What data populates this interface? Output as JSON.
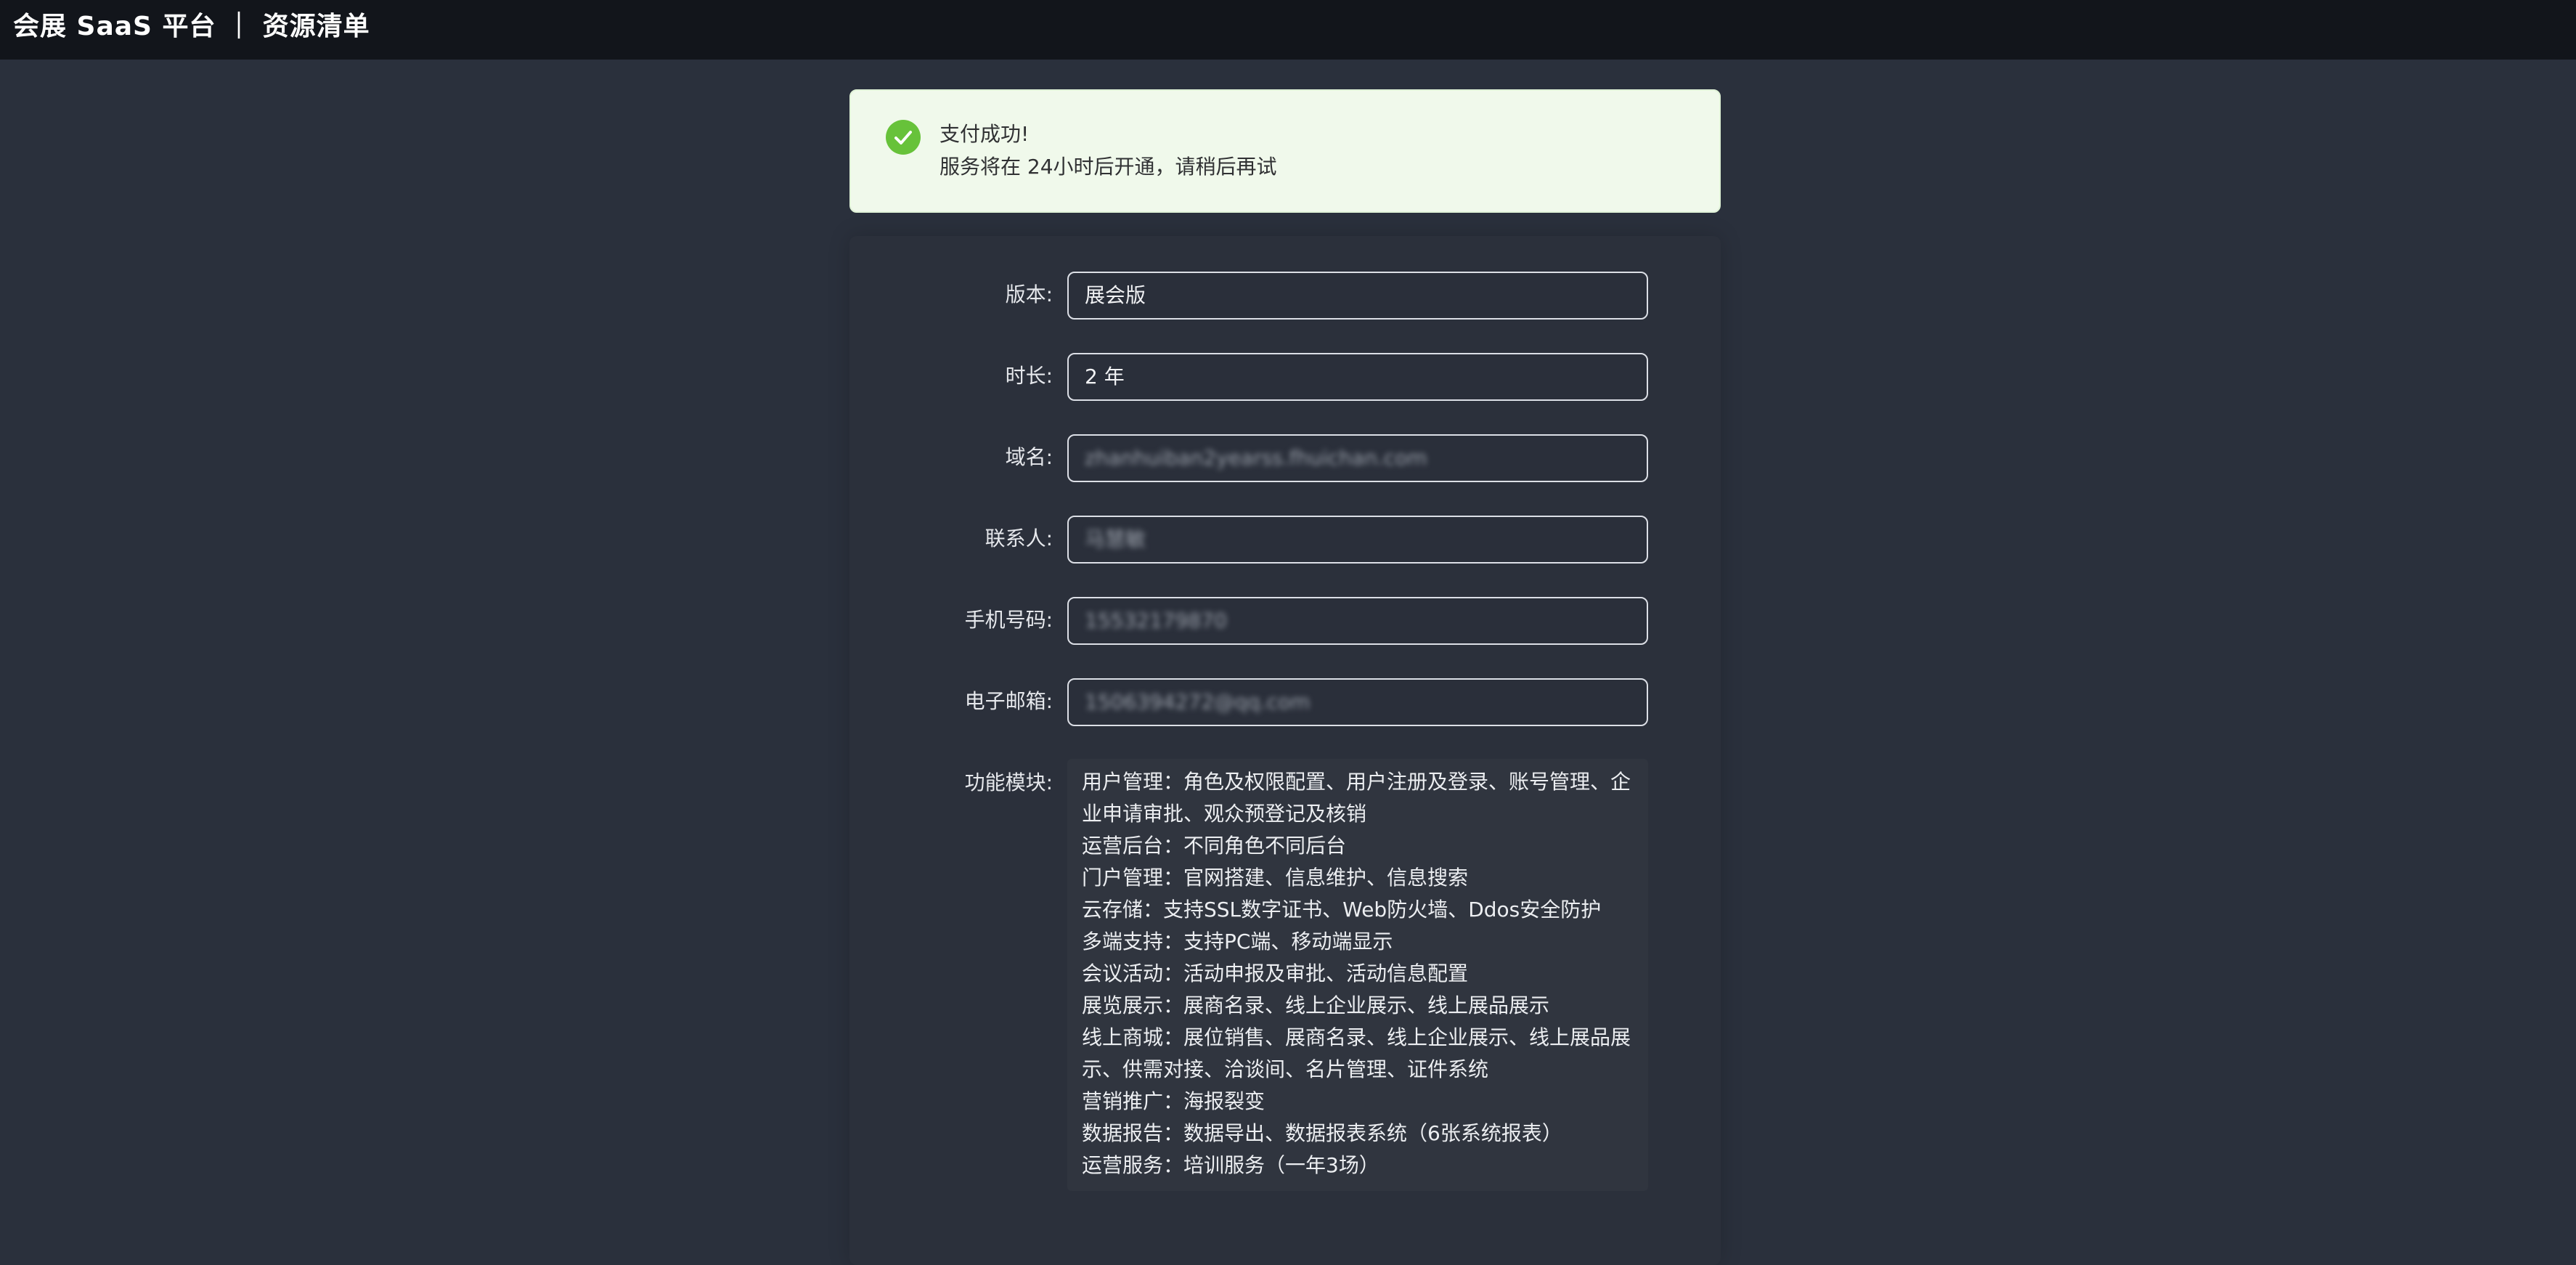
{
  "header": {
    "title": "会展 SaaS 平台 ｜ 资源清单"
  },
  "alert": {
    "title": "支付成功!",
    "message": "服务将在 24小时后开通，请稍后再试",
    "icon": "check-circle-icon",
    "color": "#67c23a"
  },
  "form": {
    "version": {
      "label": "版本:",
      "value": "展会版"
    },
    "duration": {
      "label": "时长:",
      "value": "2 年"
    },
    "domain": {
      "label": "域名:",
      "value": "zhanhuiban2yearss.fhuichan.com"
    },
    "contact": {
      "label": "联系人:",
      "value": "马慧敏"
    },
    "phone": {
      "label": "手机号码:",
      "value": "15532179870"
    },
    "email": {
      "label": "电子邮箱:",
      "value": "1506394272@qq.com"
    },
    "modules": {
      "label": "功能模块:",
      "lines": [
        "用户管理：角色及权限配置、用户注册及登录、账号管理、企",
        "业申请审批、观众预登记及核销",
        "运营后台：不同角色不同后台",
        "门户管理：官网搭建、信息维护、信息搜索",
        "云存储：支持SSL数字证书、Web防火墙、Ddos安全防护",
        "多端支持：支持PC端、移动端显示",
        "会议活动：活动申报及审批、活动信息配置",
        "展览展示：展商名录、线上企业展示、线上展品展示",
        "线上商城：展位销售、展商名录、线上企业展示、线上展品展",
        "示、供需对接、洽谈间、名片管理、证件系统",
        "营销推广：海报裂变",
        "数据报告：数据导出、数据报表系统（6张系统报表）",
        "运营服务：培训服务（一年3场）"
      ]
    }
  }
}
